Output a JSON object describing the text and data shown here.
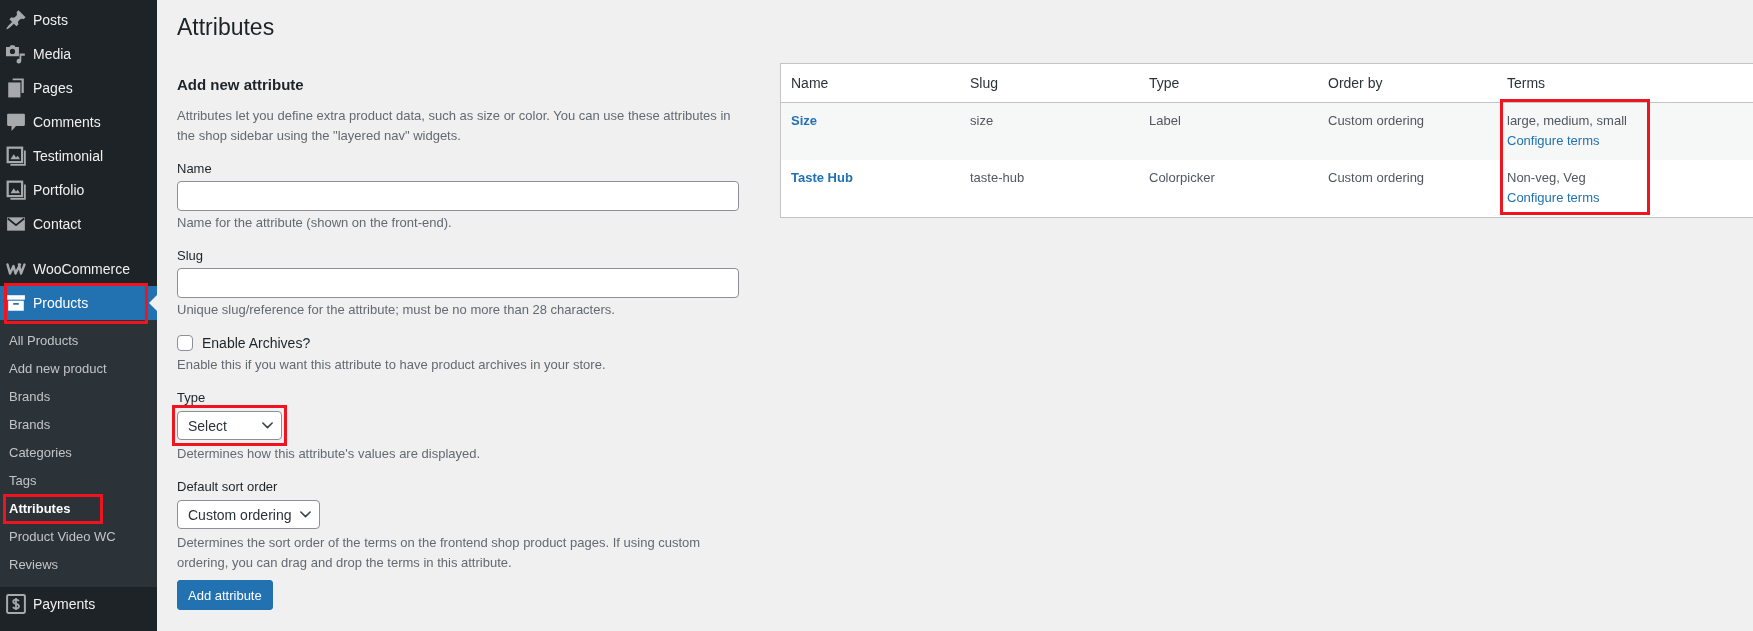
{
  "sidebar": {
    "groups": [
      {
        "items": [
          {
            "label": "Posts",
            "selected": false,
            "highlighted": false
          },
          {
            "label": "Media",
            "selected": false,
            "highlighted": false
          },
          {
            "label": "Pages",
            "selected": false,
            "highlighted": false
          },
          {
            "label": "Comments",
            "selected": false,
            "highlighted": false
          },
          {
            "label": "Testimonial",
            "selected": false,
            "highlighted": false
          },
          {
            "label": "Portfolio",
            "selected": false,
            "highlighted": false
          },
          {
            "label": "Contact",
            "selected": false,
            "highlighted": false
          }
        ]
      },
      {
        "items": [
          {
            "label": "WooCommerce",
            "selected": false,
            "highlighted": false
          },
          {
            "label": "Products",
            "selected": true,
            "highlighted": true,
            "children": [
              {
                "label": "All Products",
                "selected": false,
                "highlighted": false
              },
              {
                "label": "Add new product",
                "selected": false,
                "highlighted": false
              },
              {
                "label": "Brands",
                "selected": false,
                "highlighted": false
              },
              {
                "label": "Brands",
                "selected": false,
                "highlighted": false
              },
              {
                "label": "Categories",
                "selected": false,
                "highlighted": false
              },
              {
                "label": "Tags",
                "selected": false,
                "highlighted": false
              },
              {
                "label": "Attributes",
                "selected": true,
                "highlighted": true
              },
              {
                "label": "Product Video WC",
                "selected": false,
                "highlighted": false
              },
              {
                "label": "Reviews",
                "selected": false,
                "highlighted": false
              }
            ]
          },
          {
            "label": "Payments",
            "selected": false,
            "highlighted": false
          }
        ]
      }
    ]
  },
  "page_title": "Attributes",
  "form": {
    "title": "Add new attribute",
    "description": "Attributes let you define extra product data, such as size or color. You can use these attributes in the shop sidebar using the \"layered nav\" widgets.",
    "fields": [
      {
        "kind": "text",
        "label": "Name",
        "help": "Name for the attribute (shown on the front-end).",
        "highlighted": false
      },
      {
        "kind": "text",
        "label": "Slug",
        "help": "Unique slug/reference for the attribute; must be no more than 28 characters.",
        "highlighted": false
      },
      {
        "kind": "checkbox",
        "label": "Enable Archives?",
        "checked": false,
        "help": "Enable this if you want this attribute to have product archives in your store.",
        "highlighted": false
      },
      {
        "kind": "select",
        "label": "Type",
        "value": "Select",
        "help": "Determines how this attribute's values are displayed.",
        "highlighted": true
      },
      {
        "kind": "select",
        "label": "Default sort order",
        "value": "Custom ordering",
        "help": "Determines the sort order of the terms on the frontend shop product pages. If using custom ordering, you can drag and drop the terms in this attribute.",
        "highlighted": false
      }
    ],
    "submit": "Add attribute"
  },
  "table": {
    "columns": [
      {
        "label": "Name",
        "highlighted": false
      },
      {
        "label": "Slug",
        "highlighted": false
      },
      {
        "label": "Type",
        "highlighted": false
      },
      {
        "label": "Order by",
        "highlighted": false
      },
      {
        "label": "Terms",
        "highlighted": true
      }
    ],
    "rows": [
      {
        "name": "Size",
        "slug": "size",
        "type": "Label",
        "order_by": "Custom ordering",
        "terms": "large, medium, small",
        "terms_link": "Configure terms"
      },
      {
        "name": "Taste Hub",
        "slug": "taste-hub",
        "type": "Colorpicker",
        "order_by": "Custom ordering",
        "terms": "Non-veg, Veg",
        "terms_link": "Configure terms"
      }
    ]
  }
}
